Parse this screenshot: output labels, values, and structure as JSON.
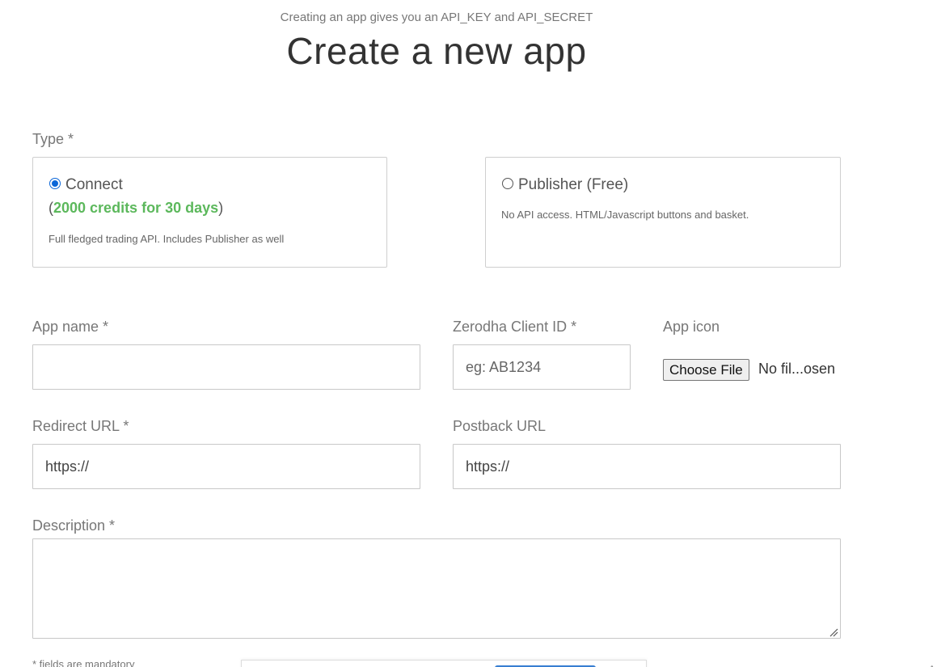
{
  "header": {
    "subtitle": "Creating an app gives you an API_KEY and API_SECRET",
    "title": "Create a new app"
  },
  "type_section": {
    "label": "Type *",
    "options": [
      {
        "label": "Connect",
        "checked": true,
        "credits_open": "(",
        "credits_text": "2000 credits for 30 days",
        "credits_close": ")",
        "description": "Full fledged trading API. Includes Publisher as well"
      },
      {
        "label": "Publisher (Free)",
        "checked": false,
        "description": "No API access. HTML/Javascript buttons and basket."
      }
    ]
  },
  "fields": {
    "app_name": {
      "label": "App name *",
      "value": "",
      "placeholder": ""
    },
    "client_id": {
      "label": "Zerodha Client ID *",
      "value": "",
      "placeholder": "eg: AB1234"
    },
    "app_icon": {
      "label": "App icon",
      "button": "Choose File",
      "status": "No fil...osen"
    },
    "redirect_url": {
      "label": "Redirect URL *",
      "value": "https://"
    },
    "postback_url": {
      "label": "Postback URL",
      "value": "https://"
    },
    "description": {
      "label": "Description *",
      "value": ""
    }
  },
  "footer": {
    "mandatory_note": "* fields are mandatory"
  },
  "colors": {
    "accent_blue": "#0a66d8",
    "credits_green": "#5cb85c",
    "button_blue": "#387ed1"
  }
}
